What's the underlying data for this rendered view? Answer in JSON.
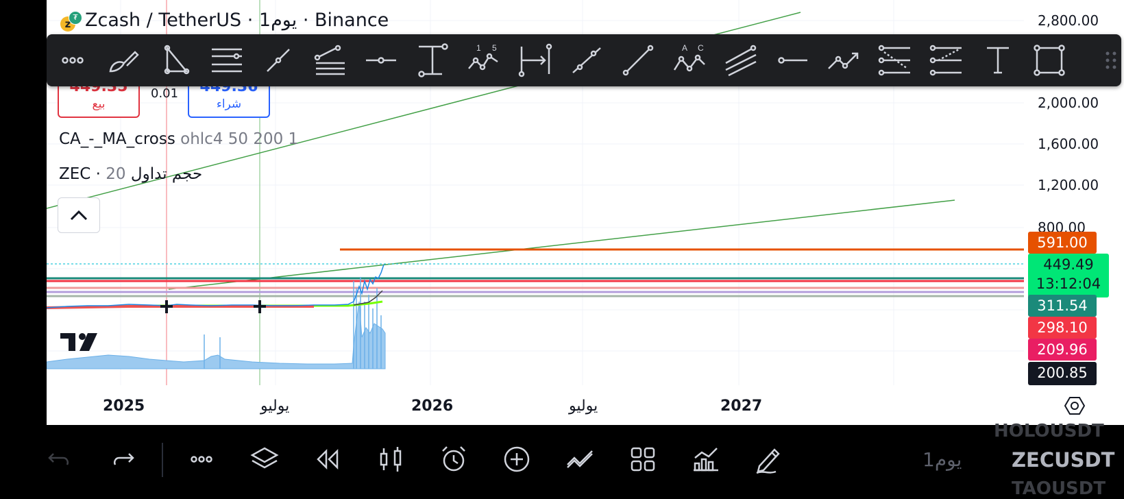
{
  "header": {
    "title": "Zcash / TetherUS · 1يوم · Binance",
    "icon": "zec-usdt-coin-icon"
  },
  "order": {
    "sell_price": "449.35",
    "sell_label": "بيع",
    "spread": "0.01",
    "buy_price": "449.36",
    "buy_label": "شراء"
  },
  "legends": {
    "ma_name": "CA_-_MA_cross",
    "ma_params": "ohlc4 50 200 1",
    "vol_name": "ZEC · حجم تداول",
    "vol_params": "20"
  },
  "toolbar": {
    "tools": [
      "more-icon",
      "brush-icon",
      "triangle-icon",
      "horizontal-lines-icon",
      "trend-line-icon",
      "fib-retracement-icon",
      "horizontal-ray-icon",
      "price-range-icon",
      "elliott-wave-icon",
      "date-range-icon",
      "parallel-trend-icon",
      "ray-icon",
      "abcd-pattern-icon",
      "channel-icon",
      "horizontal-line-icon",
      "path-icon",
      "regression-trend-icon",
      "fib-extension-icon",
      "text-icon",
      "rectangle-icon"
    ],
    "labels": {
      "elliott_a": "1",
      "elliott_b": "5",
      "abcd_a": "A",
      "abcd_b": "C",
      "text_glyph": "T"
    }
  },
  "price_scale": {
    "ticks": [
      "2,800.00",
      "2,000.00",
      "1,600.00",
      "1,200.00",
      "800.00"
    ],
    "tag_591": "591.00",
    "tag_current_price": "449.49",
    "tag_current_countdown": "13:12:04",
    "tag_311": "311.54",
    "tag_298": "298.10",
    "tag_209": "209.96",
    "tag_partial": "200.85"
  },
  "time_axis": {
    "labels": [
      "2025",
      "يوليو",
      "2026",
      "يوليو",
      "2027"
    ]
  },
  "bottom_bar": {
    "interval": "1يوم",
    "symbol_prev": "HOLOUSDT",
    "symbol_current": "ZECUSDT",
    "symbol_next": "TAOUSDT"
  },
  "colors": {
    "sell": "#e13340",
    "buy": "#2962ff",
    "trendline": "#43a047",
    "level_591": "#e65100",
    "current_price": "#00e676",
    "level_311": "#1b8a7a",
    "level_298": "#f23645",
    "level_209": "#e91e63"
  }
}
